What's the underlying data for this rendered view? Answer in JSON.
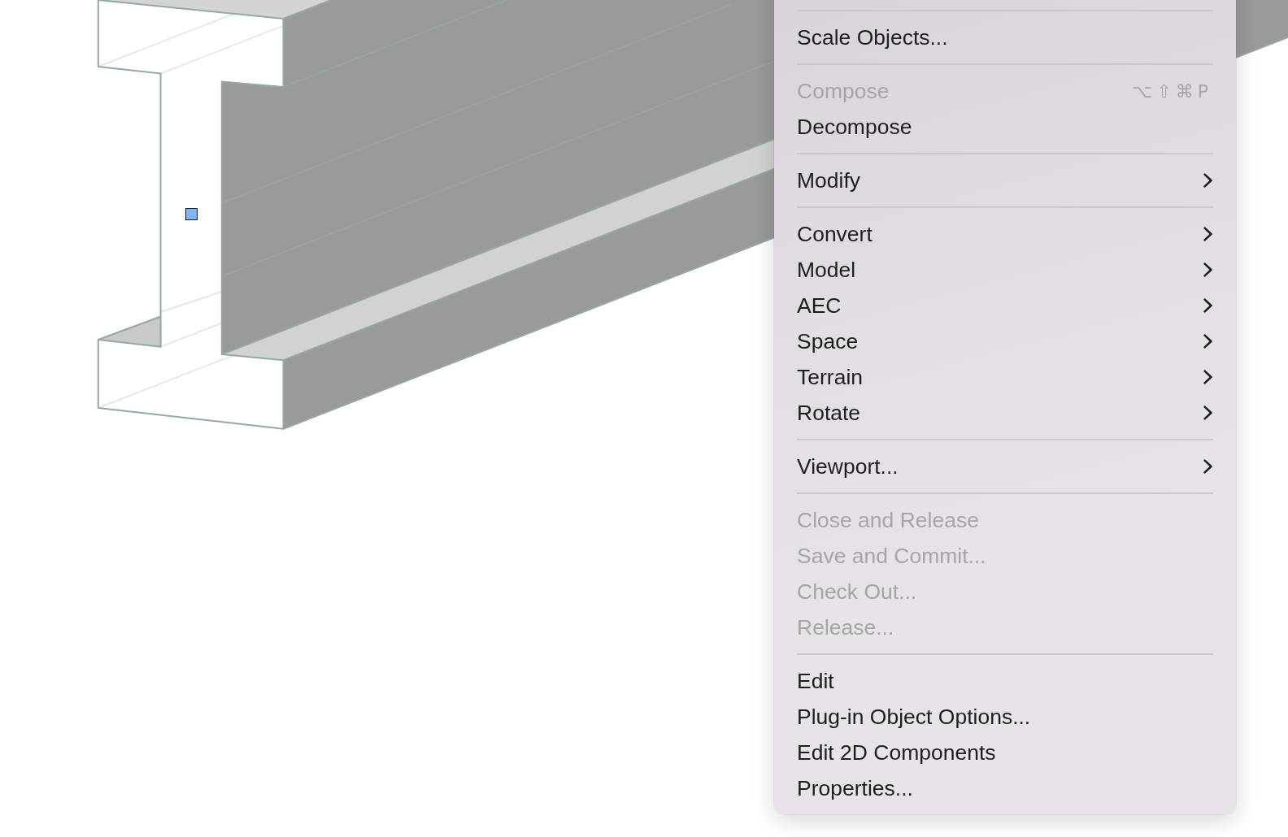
{
  "context_menu": {
    "items": [
      {
        "kind": "separator"
      },
      {
        "kind": "item",
        "label": "Scale Objects...",
        "disabled": false
      },
      {
        "kind": "separator"
      },
      {
        "kind": "item",
        "label": "Compose",
        "disabled": true,
        "shortcut": "⌥⇧⌘P"
      },
      {
        "kind": "item",
        "label": "Decompose",
        "disabled": false
      },
      {
        "kind": "separator"
      },
      {
        "kind": "submenu",
        "label": "Modify",
        "disabled": false
      },
      {
        "kind": "separator"
      },
      {
        "kind": "submenu",
        "label": "Convert",
        "disabled": false
      },
      {
        "kind": "submenu",
        "label": "Model",
        "disabled": false
      },
      {
        "kind": "submenu",
        "label": "AEC",
        "disabled": false
      },
      {
        "kind": "submenu",
        "label": "Space",
        "disabled": false
      },
      {
        "kind": "submenu",
        "label": "Terrain",
        "disabled": false
      },
      {
        "kind": "submenu",
        "label": "Rotate",
        "disabled": false
      },
      {
        "kind": "separator"
      },
      {
        "kind": "submenu",
        "label": "Viewport...",
        "disabled": false
      },
      {
        "kind": "separator"
      },
      {
        "kind": "item",
        "label": "Close and Release",
        "disabled": true
      },
      {
        "kind": "item",
        "label": "Save and Commit...",
        "disabled": true
      },
      {
        "kind": "item",
        "label": "Check Out...",
        "disabled": true
      },
      {
        "kind": "item",
        "label": "Release...",
        "disabled": true
      },
      {
        "kind": "separator"
      },
      {
        "kind": "item",
        "label": "Edit",
        "disabled": false
      },
      {
        "kind": "item",
        "label": "Plug-in Object Options...",
        "disabled": false
      },
      {
        "kind": "item",
        "label": "Edit 2D Components",
        "disabled": false
      },
      {
        "kind": "item",
        "label": "Properties...",
        "disabled": false
      }
    ]
  }
}
